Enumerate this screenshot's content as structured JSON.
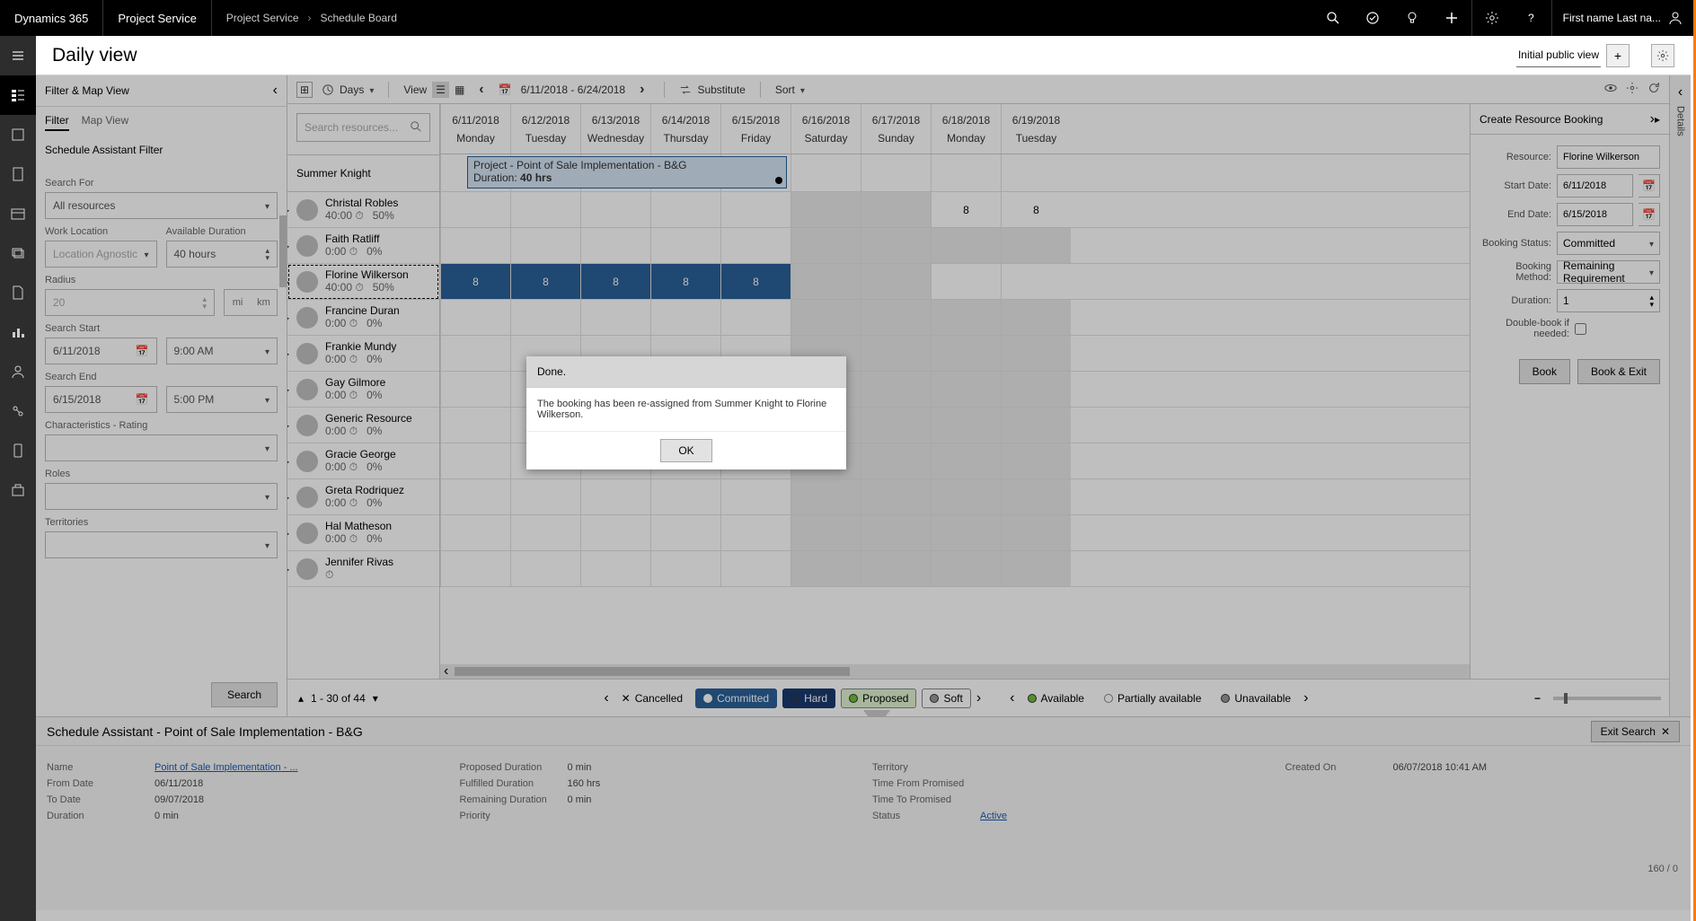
{
  "topbar": {
    "brand": "Dynamics 365",
    "app": "Project Service",
    "breadcrumb": [
      "Project Service",
      "Schedule Board"
    ],
    "user_name": "First name Last na..."
  },
  "titlebar": {
    "title": "Daily view",
    "view_name": "Initial public view"
  },
  "filter_panel": {
    "header": "Filter & Map View",
    "tabs": {
      "filter": "Filter",
      "map": "Map View"
    },
    "subheader": "Schedule Assistant Filter",
    "labels": {
      "search_for": "Search For",
      "work_location": "Work Location",
      "available_duration": "Available Duration",
      "radius": "Radius",
      "search_start": "Search Start",
      "search_end": "Search End",
      "characteristics": "Characteristics - Rating",
      "roles": "Roles",
      "territories": "Territories"
    },
    "values": {
      "search_for": "All resources",
      "work_location": "Location Agnostic",
      "available_duration": "40 hours",
      "radius": "20",
      "unit_mi": "mi",
      "unit_km": "km",
      "search_start_date": "6/11/2018",
      "search_start_time": "9:00 AM",
      "search_end_date": "6/15/2018",
      "search_end_time": "5:00 PM"
    },
    "search_button": "Search"
  },
  "board_toolbar": {
    "days": "Days",
    "view": "View",
    "date_range": "6/11/2018 - 6/24/2018",
    "substitute": "Substitute",
    "sort": "Sort"
  },
  "calendar": {
    "search_placeholder": "Search resources...",
    "pinned_resource": "Summer Knight",
    "columns": [
      {
        "date": "6/11/2018",
        "day": "Monday"
      },
      {
        "date": "6/12/2018",
        "day": "Tuesday"
      },
      {
        "date": "6/13/2018",
        "day": "Wednesday"
      },
      {
        "date": "6/14/2018",
        "day": "Thursday"
      },
      {
        "date": "6/15/2018",
        "day": "Friday"
      },
      {
        "date": "6/16/2018",
        "day": "Saturday"
      },
      {
        "date": "6/17/2018",
        "day": "Sunday"
      },
      {
        "date": "6/18/2018",
        "day": "Monday"
      },
      {
        "date": "6/19/2018",
        "day": "Tuesday"
      }
    ],
    "block": {
      "title": "Project - Point of Sale Implementation - B&G",
      "duration_label": "Duration:",
      "duration_value": "40 hrs"
    },
    "eight": "8",
    "resources": [
      {
        "name": "Christal Robles",
        "hours": "40:00",
        "pct": "50%",
        "selected": false
      },
      {
        "name": "Faith Ratliff",
        "hours": "0:00",
        "pct": "0%",
        "selected": false
      },
      {
        "name": "Florine Wilkerson",
        "hours": "40:00",
        "pct": "50%",
        "selected": true
      },
      {
        "name": "Francine Duran",
        "hours": "0:00",
        "pct": "0%",
        "selected": false
      },
      {
        "name": "Frankie Mundy",
        "hours": "0:00",
        "pct": "0%",
        "selected": false
      },
      {
        "name": "Gay Gilmore",
        "hours": "0:00",
        "pct": "0%",
        "selected": false
      },
      {
        "name": "Generic Resource",
        "hours": "0:00",
        "pct": "0%",
        "selected": false
      },
      {
        "name": "Gracie George",
        "hours": "0:00",
        "pct": "0%",
        "selected": false
      },
      {
        "name": "Greta Rodriquez",
        "hours": "0:00",
        "pct": "0%",
        "selected": false
      },
      {
        "name": "Hal Matheson",
        "hours": "0:00",
        "pct": "0%",
        "selected": false
      },
      {
        "name": "Jennifer Rivas",
        "hours": "",
        "pct": "",
        "selected": false
      }
    ]
  },
  "legend": {
    "page_text": "1 - 30 of 44",
    "cancelled": "Cancelled",
    "committed": "Committed",
    "hard": "Hard",
    "proposed": "Proposed",
    "soft": "Soft",
    "available": "Available",
    "partially": "Partially available",
    "unavailable": "Unavailable"
  },
  "booking_panel": {
    "header": "Create Resource Booking",
    "labels": {
      "resource": "Resource:",
      "start": "Start Date:",
      "end": "End Date:",
      "status": "Booking Status:",
      "method": "Booking Method:",
      "duration": "Duration:",
      "double": "Double-book if needed:"
    },
    "values": {
      "resource": "Florine Wilkerson",
      "start": "6/11/2018",
      "end": "6/15/2018",
      "status": "Committed",
      "method": "Remaining Requirement",
      "duration": "1"
    },
    "buttons": {
      "book": "Book",
      "book_exit": "Book & Exit"
    }
  },
  "bottom": {
    "title": "Schedule Assistant - Point of Sale Implementation - B&G",
    "exit": "Exit Search",
    "col1": {
      "name_k": "Name",
      "name_v": "Point of Sale Implementation - ...",
      "from_k": "From Date",
      "from_v": "06/11/2018",
      "to_k": "To Date",
      "to_v": "09/07/2018",
      "dur_k": "Duration",
      "dur_v": "0 min"
    },
    "col2": {
      "prop_k": "Proposed Duration",
      "prop_v": "0 min",
      "ful_k": "Fulfilled Duration",
      "ful_v": "160 hrs",
      "rem_k": "Remaining Duration",
      "rem_v": "0 min",
      "pri_k": "Priority",
      "pri_v": ""
    },
    "col3": {
      "terr_k": "Territory",
      "terr_v": "",
      "tfp_k": "Time From Promised",
      "tfp_v": "",
      "ttp_k": "Time To Promised",
      "ttp_v": "",
      "stat_k": "Status",
      "stat_v": "Active"
    },
    "col4": {
      "created_k": "Created On",
      "created_v": "06/07/2018 10:41 AM"
    },
    "paging": "160 / 0"
  },
  "modal": {
    "title": "Done.",
    "body": "The booking has been re-assigned from Summer Knight to Florine Wilkerson.",
    "ok": "OK"
  },
  "details_rail": "Details"
}
